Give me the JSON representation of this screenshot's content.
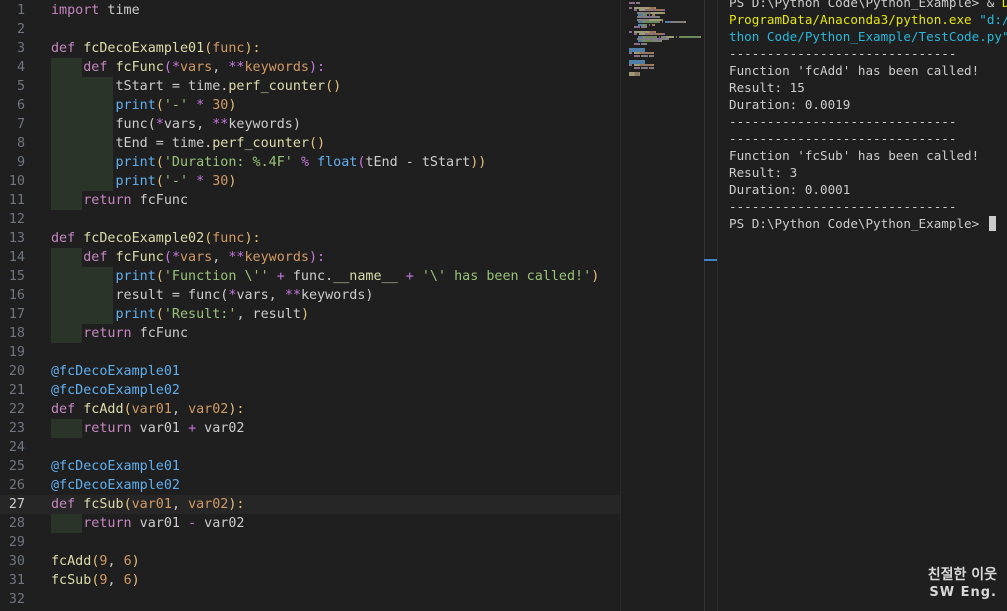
{
  "editor": {
    "current_line": 27,
    "lines": [
      {
        "num": "1",
        "tokens": [
          {
            "t": "import",
            "c": "kw"
          },
          {
            "t": " time",
            "c": "pl"
          }
        ]
      },
      {
        "num": "2",
        "tokens": []
      },
      {
        "num": "3",
        "tokens": [
          {
            "t": "def",
            "c": "kw"
          },
          {
            "t": " ",
            "c": "pl"
          },
          {
            "t": "fcDecoExample01",
            "c": "fn"
          },
          {
            "t": "(",
            "c": "br1"
          },
          {
            "t": "func",
            "c": "pm"
          },
          {
            "t": "):",
            "c": "br1"
          }
        ]
      },
      {
        "num": "4",
        "guides": 1,
        "tokens": [
          {
            "t": "    ",
            "c": "pl"
          },
          {
            "t": "def",
            "c": "kw"
          },
          {
            "t": " ",
            "c": "pl"
          },
          {
            "t": "fcFunc",
            "c": "fn"
          },
          {
            "t": "(",
            "c": "br2"
          },
          {
            "t": "*",
            "c": "op"
          },
          {
            "t": "vars",
            "c": "pm"
          },
          {
            "t": ", ",
            "c": "pl"
          },
          {
            "t": "**",
            "c": "op"
          },
          {
            "t": "keywords",
            "c": "pm"
          },
          {
            "t": "):",
            "c": "br2"
          }
        ]
      },
      {
        "num": "5",
        "guides": 2,
        "tokens": [
          {
            "t": "        tStart = time.",
            "c": "pl"
          },
          {
            "t": "perf_counter",
            "c": "fn"
          },
          {
            "t": "()",
            "c": "br1"
          }
        ]
      },
      {
        "num": "6",
        "guides": 2,
        "tokens": [
          {
            "t": "        ",
            "c": "pl"
          },
          {
            "t": "print",
            "c": "fnb"
          },
          {
            "t": "(",
            "c": "br1"
          },
          {
            "t": "'-'",
            "c": "str"
          },
          {
            "t": " ",
            "c": "pl"
          },
          {
            "t": "*",
            "c": "op"
          },
          {
            "t": " ",
            "c": "pl"
          },
          {
            "t": "30",
            "c": "num"
          },
          {
            "t": ")",
            "c": "br1"
          }
        ]
      },
      {
        "num": "7",
        "guides": 2,
        "tokens": [
          {
            "t": "        func(",
            "c": "pl"
          },
          {
            "t": "*",
            "c": "op"
          },
          {
            "t": "vars, ",
            "c": "pl"
          },
          {
            "t": "**",
            "c": "op"
          },
          {
            "t": "keywords)",
            "c": "pl"
          }
        ]
      },
      {
        "num": "8",
        "guides": 2,
        "tokens": [
          {
            "t": "        tEnd = time.",
            "c": "pl"
          },
          {
            "t": "perf_counter",
            "c": "fn"
          },
          {
            "t": "()",
            "c": "br1"
          }
        ]
      },
      {
        "num": "9",
        "guides": 2,
        "tokens": [
          {
            "t": "        ",
            "c": "pl"
          },
          {
            "t": "print",
            "c": "fnb"
          },
          {
            "t": "(",
            "c": "br1"
          },
          {
            "t": "'Duration: %.4F'",
            "c": "str"
          },
          {
            "t": " ",
            "c": "pl"
          },
          {
            "t": "%",
            "c": "op"
          },
          {
            "t": " ",
            "c": "pl"
          },
          {
            "t": "float",
            "c": "fnb"
          },
          {
            "t": "(",
            "c": "br2"
          },
          {
            "t": "tEnd - tStart",
            "c": "pl"
          },
          {
            "t": "))",
            "c": "br1"
          }
        ]
      },
      {
        "num": "10",
        "guides": 2,
        "tokens": [
          {
            "t": "        ",
            "c": "pl"
          },
          {
            "t": "print",
            "c": "fnb"
          },
          {
            "t": "(",
            "c": "br1"
          },
          {
            "t": "'-'",
            "c": "str"
          },
          {
            "t": " ",
            "c": "pl"
          },
          {
            "t": "*",
            "c": "op"
          },
          {
            "t": " ",
            "c": "pl"
          },
          {
            "t": "30",
            "c": "num"
          },
          {
            "t": ")",
            "c": "br1"
          }
        ]
      },
      {
        "num": "11",
        "guides": 1,
        "tokens": [
          {
            "t": "    ",
            "c": "pl"
          },
          {
            "t": "return",
            "c": "kw"
          },
          {
            "t": " fcFunc",
            "c": "pl"
          }
        ]
      },
      {
        "num": "12",
        "tokens": []
      },
      {
        "num": "13",
        "tokens": [
          {
            "t": "def",
            "c": "kw"
          },
          {
            "t": " ",
            "c": "pl"
          },
          {
            "t": "fcDecoExample02",
            "c": "fn"
          },
          {
            "t": "(",
            "c": "br1"
          },
          {
            "t": "func",
            "c": "pm"
          },
          {
            "t": "):",
            "c": "br1"
          }
        ]
      },
      {
        "num": "14",
        "guides": 1,
        "tokens": [
          {
            "t": "    ",
            "c": "pl"
          },
          {
            "t": "def",
            "c": "kw"
          },
          {
            "t": " ",
            "c": "pl"
          },
          {
            "t": "fcFunc",
            "c": "fn"
          },
          {
            "t": "(",
            "c": "br2"
          },
          {
            "t": "*",
            "c": "op"
          },
          {
            "t": "vars",
            "c": "pm"
          },
          {
            "t": ", ",
            "c": "pl"
          },
          {
            "t": "**",
            "c": "op"
          },
          {
            "t": "keywords",
            "c": "pm"
          },
          {
            "t": "):",
            "c": "br2"
          }
        ]
      },
      {
        "num": "15",
        "guides": 2,
        "tokens": [
          {
            "t": "        ",
            "c": "pl"
          },
          {
            "t": "print",
            "c": "fnb"
          },
          {
            "t": "(",
            "c": "br1"
          },
          {
            "t": "'Function \\''",
            "c": "str"
          },
          {
            "t": " ",
            "c": "pl"
          },
          {
            "t": "+",
            "c": "op"
          },
          {
            "t": " func.",
            "c": "pl"
          },
          {
            "t": "__name__",
            "c": "fn"
          },
          {
            "t": " ",
            "c": "pl"
          },
          {
            "t": "+",
            "c": "op"
          },
          {
            "t": " ",
            "c": "pl"
          },
          {
            "t": "'\\' has been called!'",
            "c": "str"
          },
          {
            "t": ")",
            "c": "br1"
          }
        ]
      },
      {
        "num": "16",
        "guides": 2,
        "tokens": [
          {
            "t": "        result = func(",
            "c": "pl"
          },
          {
            "t": "*",
            "c": "op"
          },
          {
            "t": "vars, ",
            "c": "pl"
          },
          {
            "t": "**",
            "c": "op"
          },
          {
            "t": "keywords)",
            "c": "pl"
          }
        ]
      },
      {
        "num": "17",
        "guides": 2,
        "tokens": [
          {
            "t": "        ",
            "c": "pl"
          },
          {
            "t": "print",
            "c": "fnb"
          },
          {
            "t": "(",
            "c": "br1"
          },
          {
            "t": "'Result:'",
            "c": "str"
          },
          {
            "t": ", result",
            "c": "pl"
          },
          {
            "t": ")",
            "c": "br1"
          }
        ]
      },
      {
        "num": "18",
        "guides": 1,
        "tokens": [
          {
            "t": "    ",
            "c": "pl"
          },
          {
            "t": "return",
            "c": "kw"
          },
          {
            "t": " fcFunc",
            "c": "pl"
          }
        ]
      },
      {
        "num": "19",
        "tokens": []
      },
      {
        "num": "20",
        "tokens": [
          {
            "t": "@fcDecoExample01",
            "c": "dec"
          }
        ]
      },
      {
        "num": "21",
        "tokens": [
          {
            "t": "@fcDecoExample02",
            "c": "dec"
          }
        ]
      },
      {
        "num": "22",
        "tokens": [
          {
            "t": "def",
            "c": "kw"
          },
          {
            "t": " ",
            "c": "pl"
          },
          {
            "t": "fcAdd",
            "c": "fn"
          },
          {
            "t": "(",
            "c": "br1"
          },
          {
            "t": "var01",
            "c": "pm"
          },
          {
            "t": ", ",
            "c": "pl"
          },
          {
            "t": "var02",
            "c": "pm"
          },
          {
            "t": "):",
            "c": "br1"
          }
        ]
      },
      {
        "num": "23",
        "guides": 1,
        "tokens": [
          {
            "t": "    ",
            "c": "pl"
          },
          {
            "t": "return",
            "c": "kw"
          },
          {
            "t": " var01 ",
            "c": "pl"
          },
          {
            "t": "+",
            "c": "op"
          },
          {
            "t": " var02",
            "c": "pl"
          }
        ]
      },
      {
        "num": "24",
        "tokens": []
      },
      {
        "num": "25",
        "tokens": [
          {
            "t": "@fcDecoExample01",
            "c": "dec"
          }
        ]
      },
      {
        "num": "26",
        "tokens": [
          {
            "t": "@fcDecoExample02",
            "c": "dec"
          }
        ]
      },
      {
        "num": "27",
        "tokens": [
          {
            "t": "def",
            "c": "kw"
          },
          {
            "t": " ",
            "c": "pl"
          },
          {
            "t": "fcSub",
            "c": "fn"
          },
          {
            "t": "(",
            "c": "br1"
          },
          {
            "t": "var01",
            "c": "pm"
          },
          {
            "t": ", ",
            "c": "pl"
          },
          {
            "t": "var02",
            "c": "pm"
          },
          {
            "t": "):",
            "c": "br1"
          }
        ]
      },
      {
        "num": "28",
        "guides": 1,
        "tokens": [
          {
            "t": "    ",
            "c": "pl"
          },
          {
            "t": "return",
            "c": "kw"
          },
          {
            "t": " var01 ",
            "c": "pl"
          },
          {
            "t": "-",
            "c": "op"
          },
          {
            "t": " var02",
            "c": "pl"
          }
        ]
      },
      {
        "num": "29",
        "tokens": []
      },
      {
        "num": "30",
        "tokens": [
          {
            "t": "fcAdd",
            "c": "fn"
          },
          {
            "t": "(",
            "c": "br1"
          },
          {
            "t": "9",
            "c": "num"
          },
          {
            "t": ", ",
            "c": "pl"
          },
          {
            "t": "6",
            "c": "num"
          },
          {
            "t": ")",
            "c": "br1"
          }
        ]
      },
      {
        "num": "31",
        "tokens": [
          {
            "t": "fcSub",
            "c": "fn"
          },
          {
            "t": "(",
            "c": "br1"
          },
          {
            "t": "9",
            "c": "num"
          },
          {
            "t": ", ",
            "c": "pl"
          },
          {
            "t": "6",
            "c": "num"
          },
          {
            "t": ")",
            "c": "br1"
          }
        ]
      },
      {
        "num": "32",
        "tokens": []
      }
    ]
  },
  "terminal": {
    "lines": [
      {
        "segments": [
          {
            "t": "PS D:\\Python Code\\Python_Example> & ",
            "c": "pl"
          },
          {
            "t": "D:/",
            "c": "t-yellow"
          }
        ]
      },
      {
        "segments": [
          {
            "t": "ProgramData/Anaconda3/python.exe",
            "c": "t-yellow"
          },
          {
            "t": " ",
            "c": "pl"
          },
          {
            "t": "\"d:/Py",
            "c": "t-cyan"
          }
        ]
      },
      {
        "segments": [
          {
            "t": "thon Code/Python_Example/TestCode.py\"",
            "c": "t-cyan"
          }
        ]
      },
      {
        "segments": [
          {
            "t": "------------------------------",
            "c": "pl"
          }
        ]
      },
      {
        "segments": [
          {
            "t": "Function 'fcAdd' has been called!",
            "c": "pl"
          }
        ]
      },
      {
        "segments": [
          {
            "t": "Result: 15",
            "c": "pl"
          }
        ]
      },
      {
        "segments": [
          {
            "t": "Duration: 0.0019",
            "c": "pl"
          }
        ]
      },
      {
        "segments": [
          {
            "t": "------------------------------",
            "c": "pl"
          }
        ]
      },
      {
        "segments": [
          {
            "t": "------------------------------",
            "c": "pl"
          }
        ]
      },
      {
        "segments": [
          {
            "t": "Function 'fcSub' has been called!",
            "c": "pl"
          }
        ]
      },
      {
        "segments": [
          {
            "t": "Result: 3",
            "c": "pl"
          }
        ]
      },
      {
        "segments": [
          {
            "t": "Duration: 0.0001",
            "c": "pl"
          }
        ]
      },
      {
        "segments": [
          {
            "t": "------------------------------",
            "c": "pl"
          }
        ]
      },
      {
        "segments": [
          {
            "t": "PS D:\\Python Code\\Python_Example> ",
            "c": "pl"
          }
        ],
        "cursor": true
      }
    ]
  },
  "watermark": {
    "line1": "친절한 이웃",
    "line2": "SW Eng."
  }
}
